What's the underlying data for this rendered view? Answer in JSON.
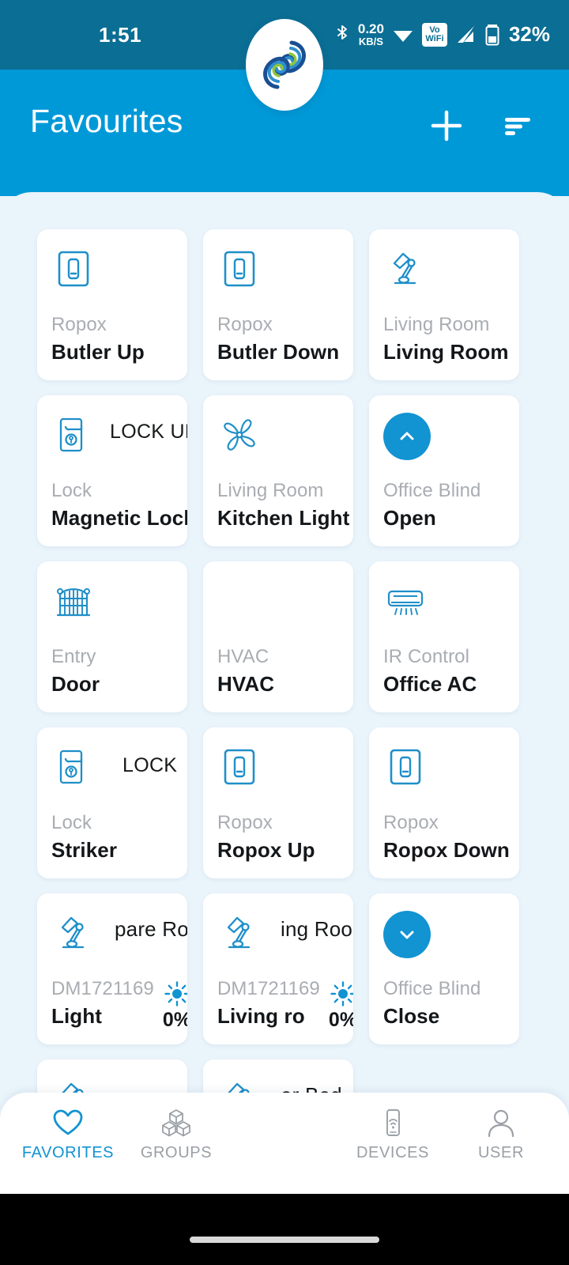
{
  "status_bar": {
    "time": "1:51",
    "bluetooth_icon": "bluetooth-icon",
    "data_rate_value": "0.20",
    "data_rate_unit": "KB/S",
    "wifi_icon": "wifi-icon",
    "vowifi_line1": "Vo",
    "vowifi_line2": "WiFi",
    "signal_icon": "cellular-signal-icon",
    "battery_icon": "battery-icon",
    "battery_percent": "32%"
  },
  "app_bar": {
    "title": "Favourites",
    "add_icon": "plus-icon",
    "sort_icon": "sort-icon"
  },
  "theme": {
    "status_bar_bg": "#0b6e94",
    "app_bar_bg": "#0099d8",
    "content_bg": "#eaf4fb",
    "card_bg": "#ffffff",
    "accent": "#1293d2",
    "icon_stroke": "#1f8fc9",
    "subtitle_color": "#a9adb2",
    "title_color": "#14171a",
    "nav_inactive": "#9aa0a6"
  },
  "cards": [
    {
      "icon": "light-switch-icon",
      "subtitle": "Ropox",
      "title": "Butler Up",
      "actions": "",
      "brightness": ""
    },
    {
      "icon": "light-switch-icon",
      "subtitle": "Ropox",
      "title": "Butler Down",
      "actions": "",
      "brightness": ""
    },
    {
      "icon": "desk-lamp-icon",
      "subtitle": "Living Room",
      "title": "Living Room",
      "actions": "",
      "brightness": ""
    },
    {
      "icon": "door-lock-icon",
      "subtitle": "Lock",
      "title": "Magnetic Lock  Mo",
      "actions": "LOCK   UNLOCK",
      "brightness": "",
      "clipped": true
    },
    {
      "icon": "ceiling-fan-icon",
      "subtitle": "Living Room",
      "title": "Kitchen Light",
      "actions": "",
      "brightness": ""
    },
    {
      "icon": "blind-open-icon",
      "subtitle": "Office Blind",
      "title": "Open",
      "actions": "",
      "brightness": ""
    },
    {
      "icon": "gate-icon",
      "subtitle": "Entry",
      "title": "Door",
      "actions": "",
      "brightness": ""
    },
    {
      "icon": "none",
      "subtitle": "HVAC",
      "title": "HVAC",
      "actions": "",
      "brightness": ""
    },
    {
      "icon": "air-conditioner-icon",
      "subtitle": "IR Control",
      "title": "Office AC",
      "actions": "",
      "brightness": ""
    },
    {
      "icon": "door-lock-icon",
      "subtitle": "Lock",
      "title": "Striker",
      "actions": "LOCK",
      "brightness": ""
    },
    {
      "icon": "light-switch-icon",
      "subtitle": "Ropox",
      "title": "Ropox Up",
      "actions": "",
      "brightness": ""
    },
    {
      "icon": "light-switch-icon",
      "subtitle": "Ropox",
      "title": "Ropox Down",
      "actions": "",
      "brightness": ""
    },
    {
      "icon": "desk-lamp-icon",
      "subtitle": "DM1721169",
      "title": "Light",
      "overflow_title": "pare Ro",
      "brightness": "0%"
    },
    {
      "icon": "desk-lamp-icon",
      "subtitle": "DM1721169",
      "title": "Living ro",
      "overflow_title": "ing Roo",
      "brightness": "0%"
    },
    {
      "icon": "blind-close-icon",
      "subtitle": "Office Blind",
      "title": "Close",
      "actions": "",
      "brightness": ""
    },
    {
      "icon": "desk-lamp-icon",
      "subtitle": "",
      "title": "",
      "overflow_title": "",
      "brightness": ""
    },
    {
      "icon": "desk-lamp-icon",
      "subtitle": "",
      "title": "",
      "overflow_title": "er Bed",
      "brightness": ""
    }
  ],
  "bottom_nav": {
    "items": [
      {
        "label": "FAVORITES",
        "icon": "heart-icon",
        "active": true
      },
      {
        "label": "GROUPS",
        "icon": "cubes-icon",
        "active": false
      },
      {
        "label": "DEVICES",
        "icon": "device-wifi-icon",
        "active": false
      },
      {
        "label": "USER",
        "icon": "user-icon",
        "active": false
      }
    ],
    "fab_icon": "brand-swirl-logo"
  }
}
